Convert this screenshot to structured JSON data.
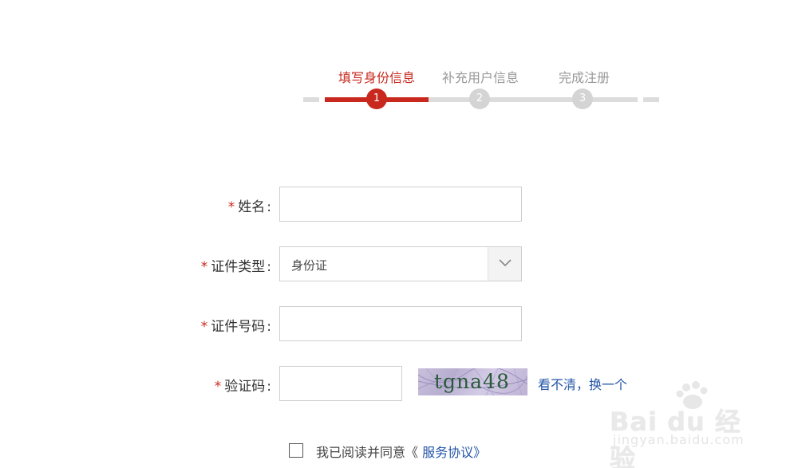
{
  "steps": [
    {
      "label": "填写身份信息",
      "number": "1",
      "active": true
    },
    {
      "label": "补充用户信息",
      "number": "2",
      "active": false
    },
    {
      "label": "完成注册",
      "number": "3",
      "active": false
    }
  ],
  "form": {
    "required_mark": "*",
    "colon": ":",
    "name_label": "姓名",
    "name_value": "",
    "id_type_label": "证件类型",
    "id_type_value": "身份证",
    "id_number_label": "证件号码",
    "id_number_value": "",
    "captcha_label": "验证码",
    "captcha_value": "",
    "captcha_code": "tgna48",
    "refresh_text": "看不清，换一个"
  },
  "agreement": {
    "checked": false,
    "text": "我已阅读并同意《",
    "link_text": "服务协议》"
  },
  "watermark": {
    "brand": "Bai du 经验",
    "url": "jingyan.baidu.com"
  },
  "colors": {
    "accent": "#c8281e",
    "link": "#2355a8",
    "inactive": "#d4d4d4"
  }
}
